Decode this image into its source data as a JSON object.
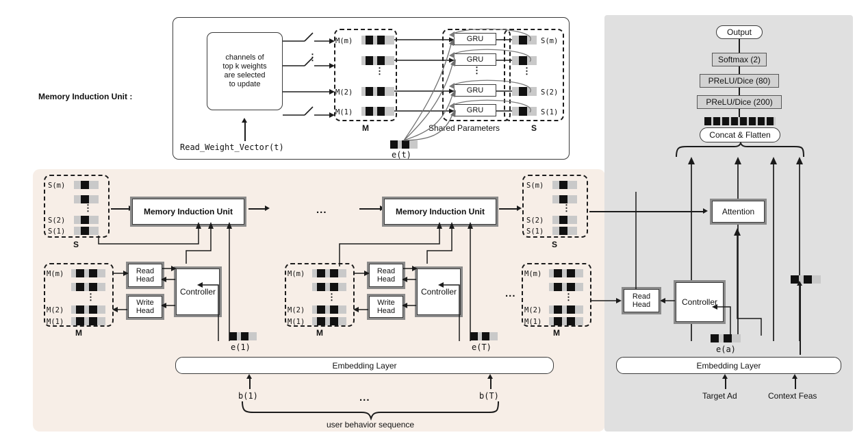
{
  "figure": {
    "miu_section_label": "Memory Induction Unit :",
    "top_unit": {
      "selector_box": "channels of\ntop k weights\nare selected\nto update",
      "selector_lines": [
        "channels of",
        "top k weights",
        "are selected",
        "to update"
      ],
      "read_weight_vector": "Read_Weight_Vector(t)",
      "memory_rows": [
        "M(m)",
        "",
        "M(2)",
        "M(1)"
      ],
      "memory_group_label": "M",
      "gru_label": "GRU",
      "gru_count": 4,
      "shared_parameters_label": "Shared Parameters",
      "state_rows": [
        "S(m)",
        "",
        "S(2)",
        "S(1)"
      ],
      "state_group_label": "S",
      "input_embedding_label": "e(t)",
      "vertical_dots": "⋮"
    },
    "left_panel": {
      "state_rows": [
        "S(m)",
        "",
        "S(2)",
        "S(1)"
      ],
      "state_group_label": "S",
      "memory_rows": [
        "M(m)",
        "",
        "M(2)",
        "M(1)"
      ],
      "memory_group_label": "M",
      "miu_label": "Memory Induction Unit",
      "read_head_label": "Read\nHead",
      "read_head_lines": [
        "Read",
        "Head"
      ],
      "write_head_label": "Write\nHead",
      "write_head_lines": [
        "Write",
        "Head"
      ],
      "controller_label": "Controller",
      "embeddings": [
        "e(1)",
        "e(T)"
      ],
      "embedding_layer_label": "Embedding Layer",
      "behavior_inputs": [
        "b(1)",
        "b(T)"
      ],
      "behavior_sequence_label": "user behavior sequence",
      "ellipsis": "...",
      "vertical_dots": "⋮"
    },
    "right_panel": {
      "output_label": "Output",
      "softmax_label": "Softmax (2)",
      "prelu_80_label": "PReLU/Dice (80)",
      "prelu_200_label": "PReLU/Dice (200)",
      "concat_label": "Concat & Flatten",
      "concat_squares": 8,
      "attention_label": "Attention",
      "read_head_lines": [
        "Read",
        "Head"
      ],
      "controller_label": "Controller",
      "ad_embedding_label": "e(a)",
      "embedding_layer_label": "Embedding Layer",
      "inputs": [
        "Target Ad",
        "Context Feas"
      ]
    },
    "colors": {
      "pink_panel": "#f7eee7",
      "gray_panel": "#e0e0e0",
      "cell_bar": "#c9c9c9",
      "cell_square": "#111111",
      "layer_fill": "#d2d2d2",
      "line": "#1b1b1b"
    }
  }
}
